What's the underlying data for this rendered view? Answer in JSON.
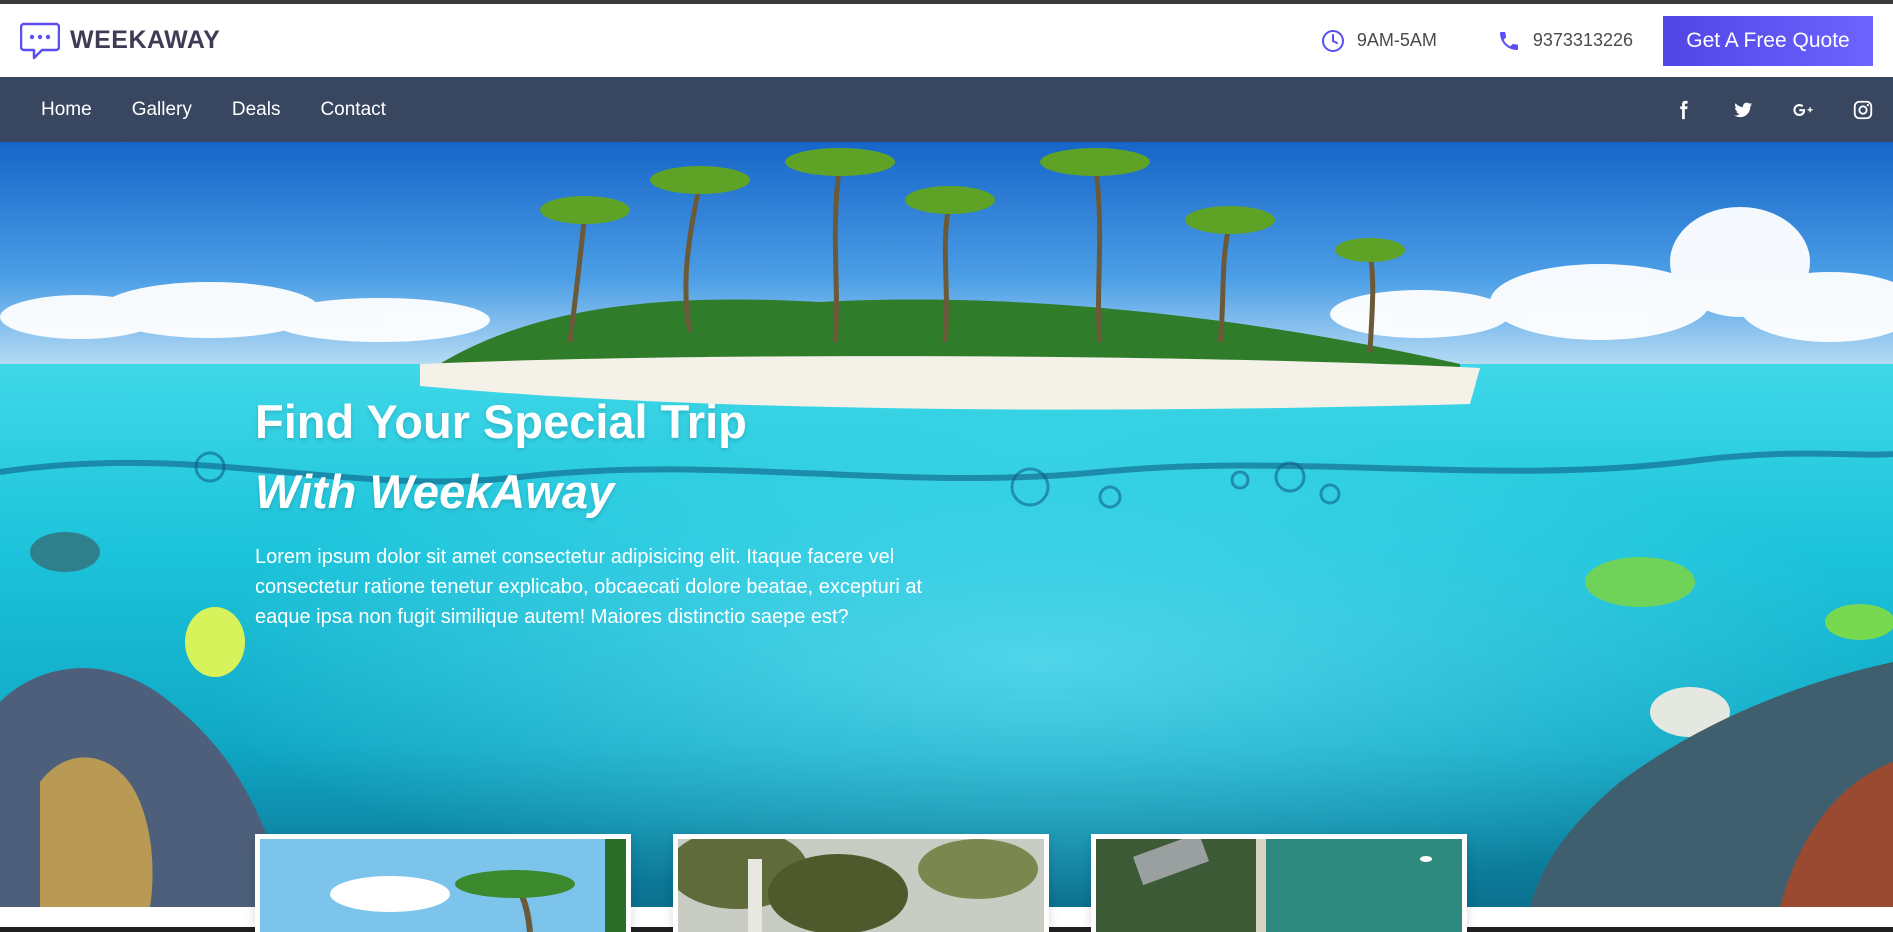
{
  "brand": {
    "name": "WEEKAWAY",
    "icon": "chat-bubble-icon"
  },
  "topbar": {
    "hours": "9AM-5AM",
    "hours_icon": "clock-icon",
    "phone": "9373313226",
    "phone_icon": "phone-icon",
    "quote_label": "Get A Free Quote"
  },
  "nav": {
    "links": [
      "Home",
      "Gallery",
      "Deals",
      "Contact"
    ],
    "socials": [
      "facebook-icon",
      "twitter-icon",
      "google-plus-icon",
      "instagram-icon"
    ]
  },
  "hero": {
    "title": "Find Your Special Trip",
    "subtitle": "With WeekAway",
    "description": "Lorem ipsum dolor sit amet consectetur adipisicing elit. Itaque facere vel consectetur ratione tenetur explicabo, obcaecati dolore beatae, excepturi at eaque ipsa non fugit similique autem! Maiores distinctio saepe est?"
  },
  "colors": {
    "accent": "#5a4ff0",
    "nav_bg": "#38465f",
    "brand_text": "#3f3d56"
  }
}
